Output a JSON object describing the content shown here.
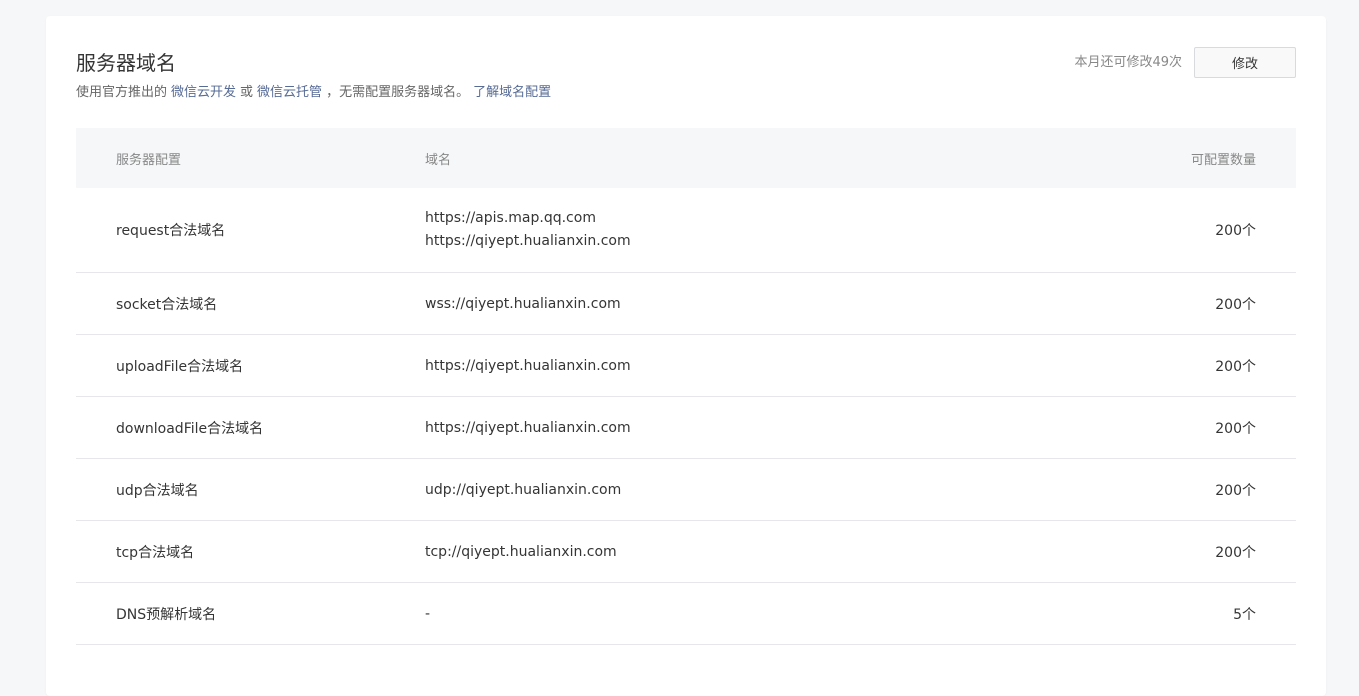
{
  "section": {
    "title": "服务器域名",
    "desc_prefix": "使用官方推出的",
    "link_cloud_dev": "微信云开发",
    "desc_or": "或",
    "link_cloud_hosting": "微信云托管",
    "desc_suffix": "，无需配置服务器域名。",
    "link_learn": "了解域名配置"
  },
  "actions": {
    "remain_text": "本月还可修改49次",
    "edit_label": "修改"
  },
  "table": {
    "headers": [
      "服务器配置",
      "域名",
      "可配置数量"
    ],
    "rows": [
      {
        "name": "request合法域名",
        "domains": [
          "https://apis.map.qq.com",
          "https://qiyept.hualianxin.com"
        ],
        "count": "200个"
      },
      {
        "name": "socket合法域名",
        "domains": [
          "wss://qiyept.hualianxin.com"
        ],
        "count": "200个"
      },
      {
        "name": "uploadFile合法域名",
        "domains": [
          "https://qiyept.hualianxin.com"
        ],
        "count": "200个"
      },
      {
        "name": "downloadFile合法域名",
        "domains": [
          "https://qiyept.hualianxin.com"
        ],
        "count": "200个"
      },
      {
        "name": "udp合法域名",
        "domains": [
          "udp://qiyept.hualianxin.com"
        ],
        "count": "200个"
      },
      {
        "name": "tcp合法域名",
        "domains": [
          "tcp://qiyept.hualianxin.com"
        ],
        "count": "200个"
      },
      {
        "name": "DNS预解析域名",
        "domains": [
          "-"
        ],
        "count": "5个"
      }
    ]
  },
  "colors": {
    "link": "#576b95",
    "header_bg": "#f6f7f9",
    "border": "#e7e7eb"
  }
}
